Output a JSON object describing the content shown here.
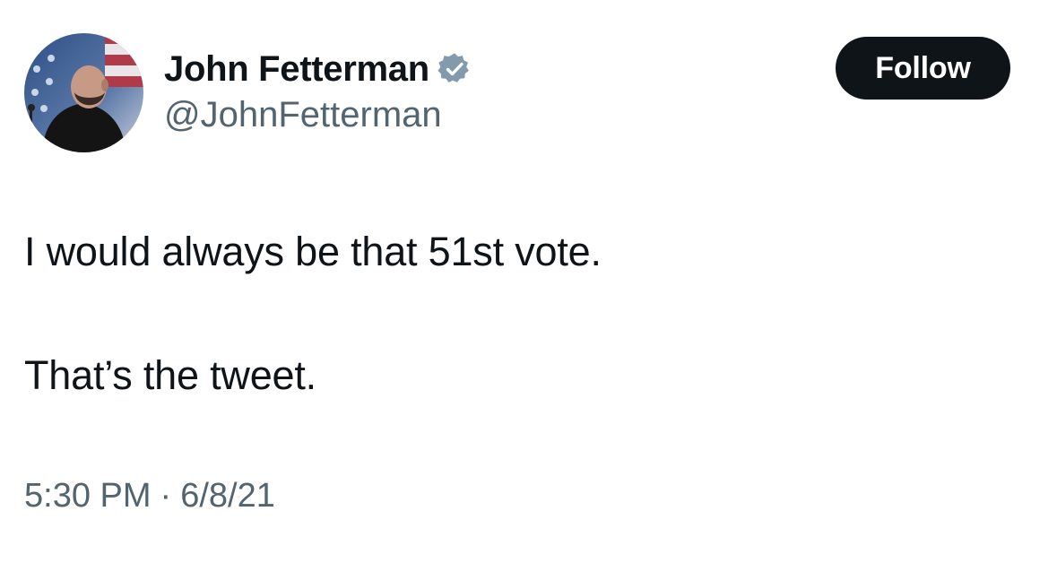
{
  "author": {
    "display_name": "John Fetterman",
    "handle": "@JohnFetterman",
    "verified_icon": "verified-badge-icon",
    "avatar": "avatar-photo"
  },
  "follow_button": {
    "label": "Follow"
  },
  "tweet": {
    "lines": [
      "I would always be that 51st vote.",
      "That’s the tweet."
    ]
  },
  "meta": {
    "time": "5:30 PM",
    "separator": "·",
    "date": "6/8/21"
  },
  "colors": {
    "text": "#0f1419",
    "secondary_text": "#536471",
    "button_bg": "#0f1419",
    "button_text": "#ffffff",
    "verified_badge": "#829aab"
  }
}
